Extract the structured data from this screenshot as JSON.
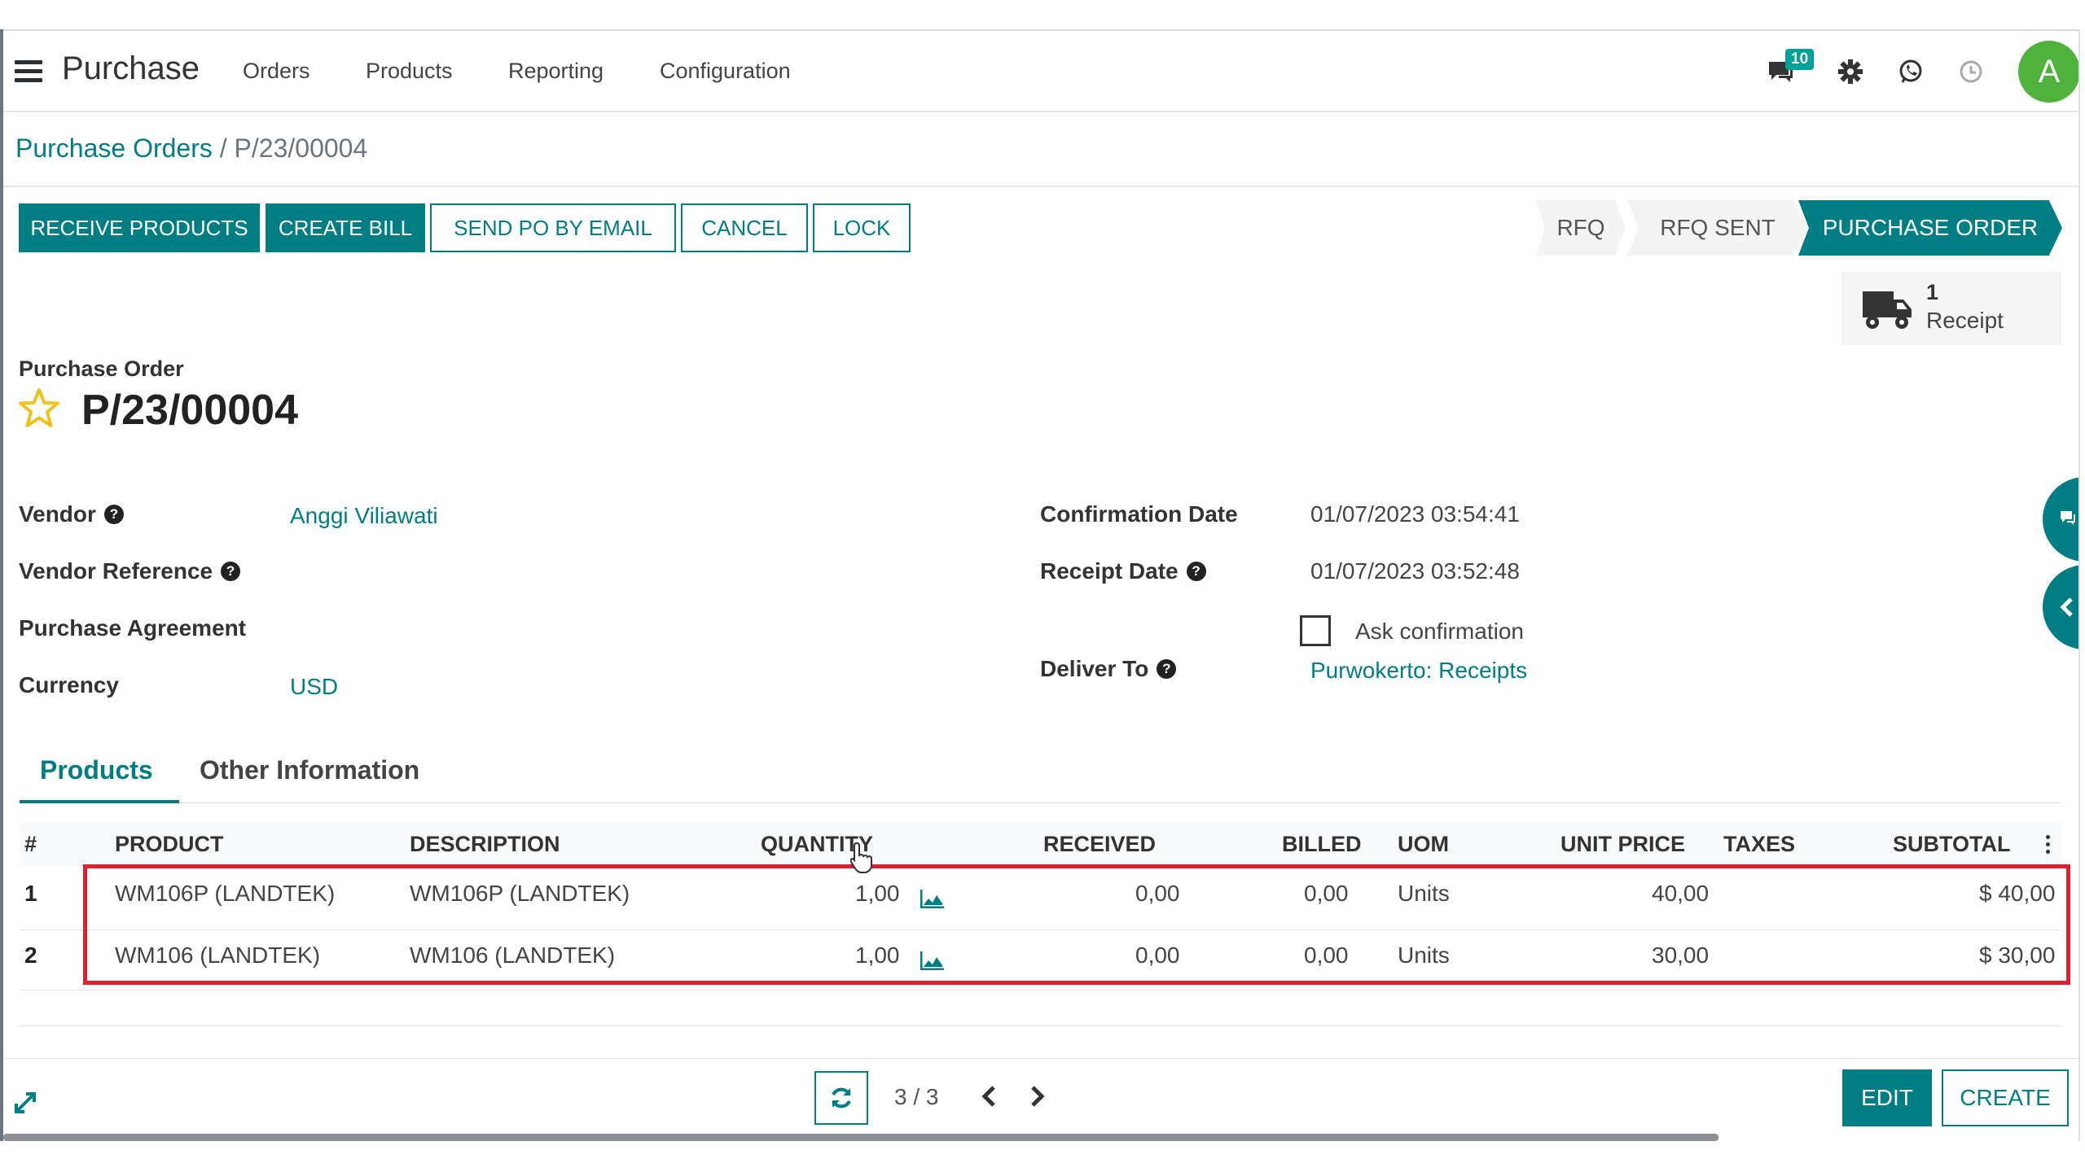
{
  "navbar": {
    "app_title": "Purchase",
    "menu": [
      "Orders",
      "Products",
      "Reporting",
      "Configuration"
    ],
    "message_badge": "10",
    "avatar_letter": "A"
  },
  "breadcrumb": {
    "parent": "Purchase Orders",
    "separator": "/",
    "current": "P/23/00004"
  },
  "actions": {
    "receive_products": "RECEIVE PRODUCTS",
    "create_bill": "CREATE BILL",
    "send_po": "SEND PO BY EMAIL",
    "cancel": "CANCEL",
    "lock": "LOCK"
  },
  "statusbar": {
    "stages": [
      "RFQ",
      "RFQ SENT",
      "PURCHASE ORDER"
    ],
    "active": "PURCHASE ORDER"
  },
  "smart_button": {
    "count": "1",
    "label": "Receipt"
  },
  "title": {
    "doc_type": "Purchase Order",
    "name": "P/23/00004"
  },
  "fields": {
    "vendor_label": "Vendor",
    "vendor_value": "Anggi Viliawati",
    "vendor_ref_label": "Vendor Reference",
    "agreement_label": "Purchase Agreement",
    "currency_label": "Currency",
    "currency_value": "USD",
    "confirmation_label": "Confirmation Date",
    "confirmation_value": "01/07/2023 03:54:41",
    "receipt_label": "Receipt Date",
    "receipt_value": "01/07/2023 03:52:48",
    "ask_confirmation": "Ask confirmation",
    "deliver_label": "Deliver To",
    "deliver_value": "Purwokerto: Receipts"
  },
  "tabs": [
    "Products",
    "Other Information"
  ],
  "table": {
    "headers": [
      "#",
      "PRODUCT",
      "DESCRIPTION",
      "QUANTITY",
      "RECEIVED",
      "BILLED",
      "UOM",
      "UNIT PRICE",
      "TAXES",
      "SUBTOTAL"
    ],
    "rows": [
      {
        "num": "1",
        "product": "WM106P (LANDTEK)",
        "description": "WM106P (LANDTEK)",
        "quantity": "1,00",
        "received": "0,00",
        "billed": "0,00",
        "uom": "Units",
        "unit_price": "40,00",
        "taxes": "",
        "subtotal": "$ 40,00"
      },
      {
        "num": "2",
        "product": "WM106 (LANDTEK)",
        "description": "WM106 (LANDTEK)",
        "quantity": "1,00",
        "received": "0,00",
        "billed": "0,00",
        "uom": "Units",
        "unit_price": "30,00",
        "taxes": "",
        "subtotal": "$ 30,00"
      }
    ]
  },
  "pager": {
    "value": "3 / 3"
  },
  "footer_buttons": {
    "edit": "EDIT",
    "create": "CREATE"
  }
}
